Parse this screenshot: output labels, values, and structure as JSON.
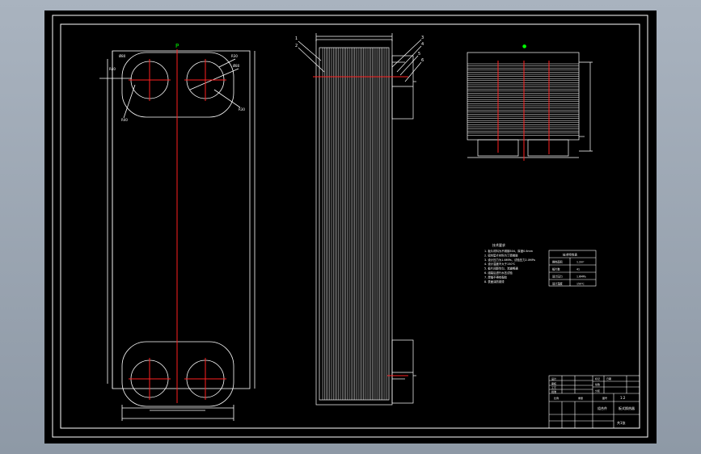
{
  "app": {
    "title": ""
  },
  "colors": {
    "background": "#000000",
    "line": "#ffffff",
    "centerline": "#ff2020",
    "marker": "#00ff00",
    "chrome": "#9aa4b1"
  },
  "front_view": {
    "top_mark": "P",
    "callouts": [
      "Ø80",
      "R30",
      "Ø80",
      "R30",
      "R40",
      "R40"
    ],
    "width_dim": "",
    "height_dim": "",
    "bottom_dim": ""
  },
  "side_view": {
    "callouts_left": [
      "1",
      "2"
    ],
    "callouts_right": [
      "3",
      "4",
      "5",
      "6"
    ],
    "top_dim": ""
  },
  "top_view": {
    "marker": "●",
    "dim_right": "",
    "dim_bottom": ""
  },
  "notes": {
    "title": "技术要求",
    "lines": [
      "1. 板片材料为不锈钢304，厚度0.6mm",
      "2. 密封垫片材料为丁腈橡胶",
      "3. 设计压力为1.6MPa，试验压力2.0MPa",
      "4. 设计温度不大于150℃",
      "5. 板片间距均匀，流道畅通",
      "6. 组装后进行水压试验",
      "7. 焊缝不得有裂纹",
      "8. 表面涂防锈漆"
    ]
  },
  "spec_table": {
    "title": "技术特性表",
    "rows": [
      [
        "换热面积",
        "1.2m²"
      ],
      [
        "板片数",
        "41"
      ],
      [
        "设计压力",
        "1.6MPa"
      ],
      [
        "设计温度",
        "150℃"
      ]
    ]
  },
  "title_block": {
    "drawing_name": "板式换热器",
    "scale": "1:2",
    "material": "组合件",
    "sheet": "共1张",
    "cells": [
      "设计",
      "审核",
      "工艺",
      "批准",
      "标记",
      "处数",
      "分区",
      "日期",
      "比例",
      "重量",
      "图号"
    ]
  }
}
